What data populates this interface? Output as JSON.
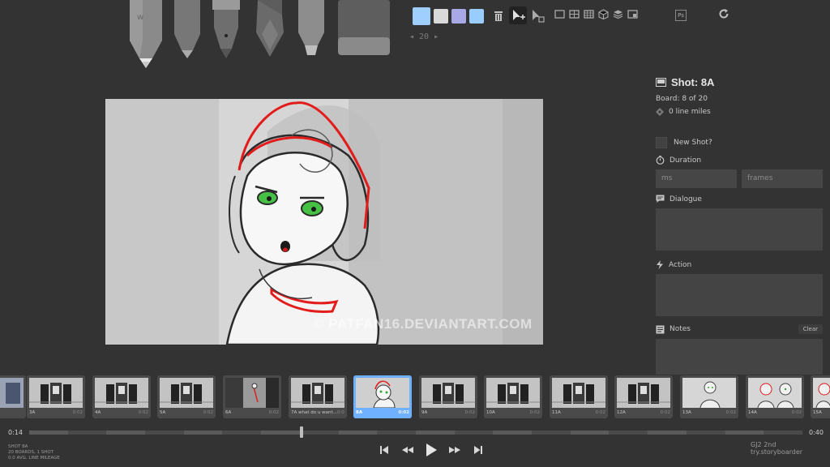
{
  "tools": [
    {
      "name": "pencil",
      "selected": false
    },
    {
      "name": "light-pencil",
      "selected": false
    },
    {
      "name": "pen",
      "selected": false
    },
    {
      "name": "brush",
      "selected": false
    },
    {
      "name": "marker",
      "selected": false
    },
    {
      "name": "eraser",
      "selected": false
    }
  ],
  "colors": {
    "swatches": [
      "#9fcfff",
      "#d9d9d9",
      "#a8a8e6",
      "#99ccff"
    ],
    "accent": "#6fb1ff",
    "background": "#333333",
    "panel_field": "#444444"
  },
  "brush_size": "20",
  "panel": {
    "shot_title": "Shot: 8A",
    "board_info": "Board: 8 of 20",
    "line_miles": "0 line miles",
    "new_shot_label": "New Shot?",
    "duration_label": "Duration",
    "ms_placeholder": "ms",
    "frames_placeholder": "frames",
    "dialogue_label": "Dialogue",
    "action_label": "Action",
    "notes_label": "Notes",
    "clear_label": "Clear"
  },
  "watermark": "© PATFAN16.DEVIANTART.COM",
  "thumbnails": [
    {
      "label": "",
      "duration": "",
      "kind": "partial"
    },
    {
      "label": "3A",
      "duration": "0:02",
      "kind": "cabinet"
    },
    {
      "label": "4A",
      "duration": "0:02",
      "kind": "cabinet"
    },
    {
      "label": "5A",
      "duration": "0:02",
      "kind": "cabinet"
    },
    {
      "label": "6A",
      "duration": "0:02",
      "kind": "dark"
    },
    {
      "label": "7A what do u want...",
      "duration": "0:02",
      "kind": "cabinet"
    },
    {
      "label": "8A",
      "duration": "0:02",
      "kind": "girl",
      "selected": true
    },
    {
      "label": "9A",
      "duration": "0:02",
      "kind": "cabinet"
    },
    {
      "label": "10A",
      "duration": "0:02",
      "kind": "cabinet"
    },
    {
      "label": "11A",
      "duration": "0:02",
      "kind": "cabinet"
    },
    {
      "label": "12A",
      "duration": "0:02",
      "kind": "cabinet"
    },
    {
      "label": "13A",
      "duration": "0:02",
      "kind": "boy"
    },
    {
      "label": "14A",
      "duration": "0:02",
      "kind": "pair"
    },
    {
      "label": "15A",
      "duration": "",
      "kind": "partial2"
    }
  ],
  "timeline": {
    "start": "0:14",
    "end": "0:40",
    "position": 0.35
  },
  "stats": {
    "line1": "SHOT 8A",
    "line2": "20 BOARDS, 1 SHOT",
    "line3": "0.0 AVG. LINE MILEAGE"
  },
  "filename": "GJ2 2nd try.storyboarder"
}
